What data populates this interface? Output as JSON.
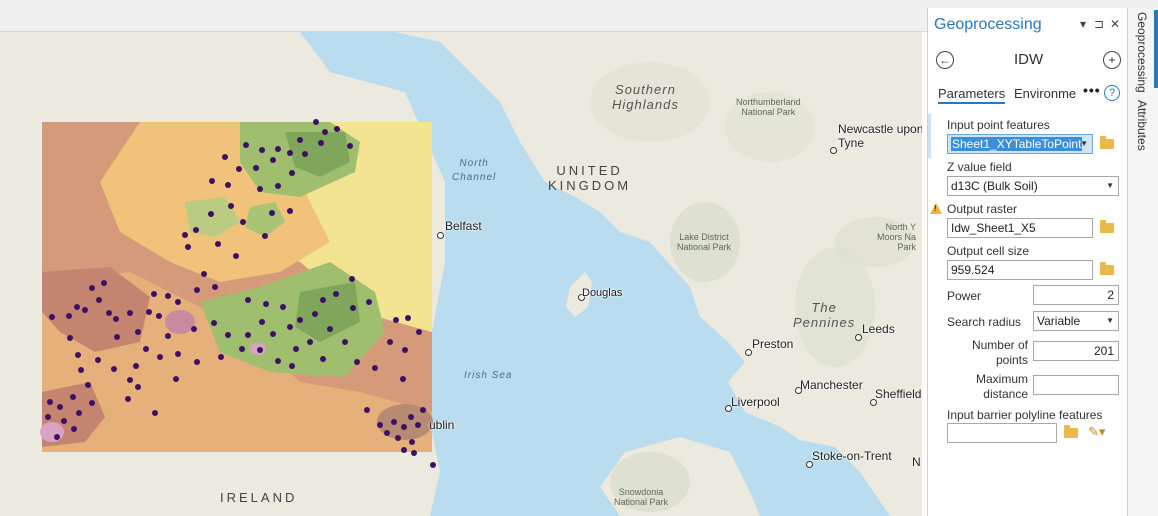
{
  "panel": {
    "title": "Geoprocessing",
    "controls": {
      "dropdown": "▾",
      "pin": "⊐",
      "close": "✕"
    },
    "tool_name": "IDW",
    "tabs": [
      "Parameters",
      "Environme"
    ],
    "more": "•••",
    "help": "?",
    "params": {
      "input_point_features": {
        "label": "Input point features",
        "value": "Sheet1_XYTableToPoint"
      },
      "z_value_field": {
        "label": "Z value field",
        "value": "d13C (Bulk Soil)"
      },
      "output_raster": {
        "label": "Output raster",
        "value": "Idw_Sheet1_X5"
      },
      "output_cell_size": {
        "label": "Output cell size",
        "value": "959.524"
      },
      "power": {
        "label": "Power",
        "value": "2"
      },
      "search_radius": {
        "label": "Search radius",
        "value": "Variable"
      },
      "number_of_points": {
        "label_line1": "Number of",
        "label_line2": "points",
        "value": "201"
      },
      "maximum_distance": {
        "label_line1": "Maximum",
        "label_line2": "distance",
        "value": ""
      },
      "input_barrier": {
        "label": "Input barrier polyline features",
        "value": ""
      }
    }
  },
  "right_tabs": [
    "Geoprocessing",
    "Attributes"
  ],
  "map": {
    "places": {
      "belfast": "Belfast",
      "douglas": "Douglas",
      "newcastle_line1": "Newcastle upon",
      "newcastle_line2": "Tyne",
      "leeds": "Leeds",
      "preston": "Preston",
      "manchester": "Manchester",
      "sheffield": "Sheffield",
      "liverpool": "Liverpool",
      "stoke": "Stoke-on-Trent",
      "dublin_partial": "ublin",
      "n_partial": "N"
    },
    "regions": {
      "southern_highlands_1": "Southern",
      "southern_highlands_2": "Highlands",
      "pennines_1": "The",
      "pennines_2": "Pennines",
      "uk_1": "UNITED",
      "uk_2": "KINGDOM",
      "ireland": "IRELAND"
    },
    "waters": {
      "north_channel_1": "North",
      "north_channel_2": "Channel",
      "irish_sea": "Irish Sea"
    },
    "parks": {
      "northumberland_1": "Northumberland",
      "northumberland_2": "National Park",
      "lake_district_1": "Lake District",
      "lake_district_2": "National Park",
      "north_york_1": "North Y",
      "north_york_2": "Moors Na",
      "north_york_3": "Park",
      "snowdonia_1": "Snowdonia",
      "snowdonia_2": "National Park"
    },
    "colors": {
      "sea": "#b9dcee",
      "land": "#ece9df",
      "idw_high": "#7fa65a",
      "idw_mid": "#f0e08a",
      "idw_low": "#c48470",
      "points": "#3d1066"
    }
  }
}
